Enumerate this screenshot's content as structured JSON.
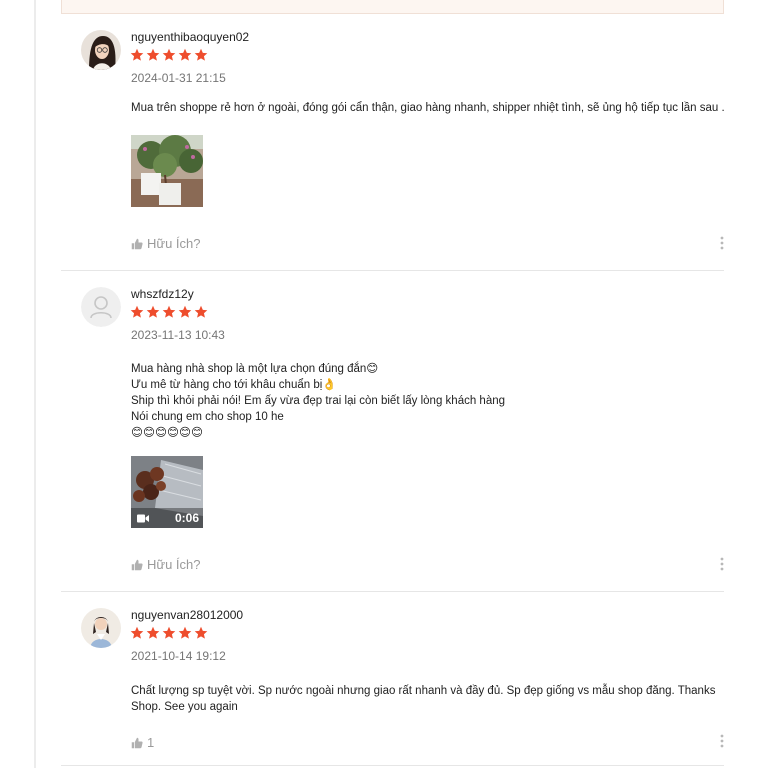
{
  "reviews": [
    {
      "username": "nguyenthibaoquyen02",
      "rating": 5,
      "date": "2024-01-31 21:15",
      "comment_lines": [
        "Mua trên shoppe rẻ hơn ở ngoài, đóng gói cẩn thận, giao hàng nhanh, shipper nhiệt tình, sẽ ủng hộ tiếp tục lần sau ."
      ],
      "helpful_label": "Hữu Ích?"
    },
    {
      "username": "whszfdz12y",
      "rating": 5,
      "date": "2023-11-13 10:43",
      "comment_lines": [
        "Mua hàng nhà shop là một lựa chọn đúng đắn😊",
        "Ưu mê từ hàng cho tới khâu chuẩn bị👌",
        "Ship thì khỏi phải nói! Em ấy vừa đẹp trai lại còn biết lấy lòng khách hàng",
        "Nói chung em cho shop 10 he",
        "😊😊😊😊😊😊"
      ],
      "video_duration": "0:06",
      "helpful_label": "Hữu Ích?"
    },
    {
      "username": "nguyenvan28012000",
      "rating": 5,
      "date": "2021-10-14 19:12",
      "comment_lines": [
        "Chất lượng sp tuyệt vời. Sp nước ngoài nhưng giao rất nhanh và đầy đủ. Sp đẹp giống vs mẫu shop đăng. Thanks",
        "Shop. See you again"
      ],
      "helpful_label": "1"
    }
  ],
  "colors": {
    "star": "#ee4d2d",
    "muted": "#757575",
    "divider": "#e6e6e6"
  },
  "icons": [
    "star-icon",
    "thumbs-up-icon",
    "more-vertical-icon",
    "video-camera-icon",
    "default-avatar-icon"
  ]
}
